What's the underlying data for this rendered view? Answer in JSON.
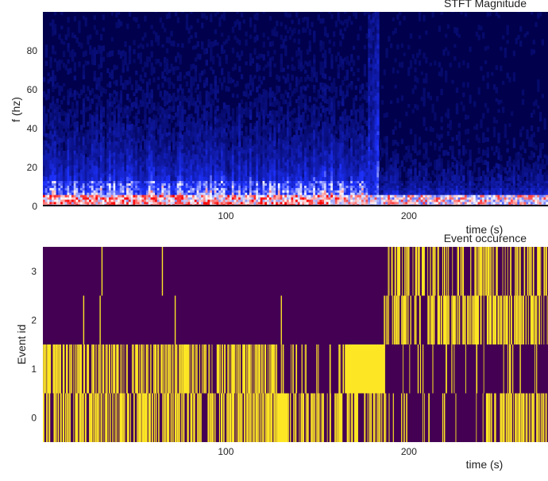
{
  "chart_data": [
    {
      "type": "heatmap",
      "title": "STFT Magnitude",
      "xlabel": "time (s)",
      "ylabel": "f (hz)",
      "xlim": [
        0,
        276
      ],
      "ylim": [
        0,
        100
      ],
      "xticks": [
        100,
        200
      ],
      "yticks": [
        0,
        20,
        40,
        60,
        80
      ],
      "colormap": "seismic (dark blue low, white mid, red high)",
      "grid": false,
      "regions": [
        {
          "t_start": 0,
          "t_end": 177,
          "description": "broadband energy, strong below 10 Hz, blue streaks up to ~90 Hz"
        },
        {
          "t_start": 177,
          "t_end": 183,
          "description": "transient spike extending to ~100 Hz"
        },
        {
          "t_start": 188,
          "t_end": 276,
          "description": "quieter, energy mostly below 25 Hz, red at 0-5 Hz"
        }
      ]
    },
    {
      "type": "heatmap",
      "title": "Event occurence",
      "xlabel": "time (s)",
      "ylabel": "Event id",
      "xlim": [
        0,
        276
      ],
      "xticks": [
        100,
        200
      ],
      "yticks": [
        0,
        1,
        2,
        3
      ],
      "colormap": "viridis endpoints (0 = #440154 dark purple, 1 = #fde725 yellow)",
      "grid": false,
      "rows": [
        {
          "event_id": 0,
          "description": "very dense activity 0-186 s, solid block ~128-134 s, sparse after 187 s, dense again 240-276 s"
        },
        {
          "event_id": 1,
          "description": "dense activity 0-128 s, solid block ~165-187 s, sparse after 188 s"
        },
        {
          "event_id": 2,
          "description": "rare events before 186 s (~22, 31, 72, 130 s), very dense 186-276 s"
        },
        {
          "event_id": 3,
          "description": "rare events before 188 s (~32, 65 s), dense 188-276 s"
        }
      ]
    }
  ]
}
